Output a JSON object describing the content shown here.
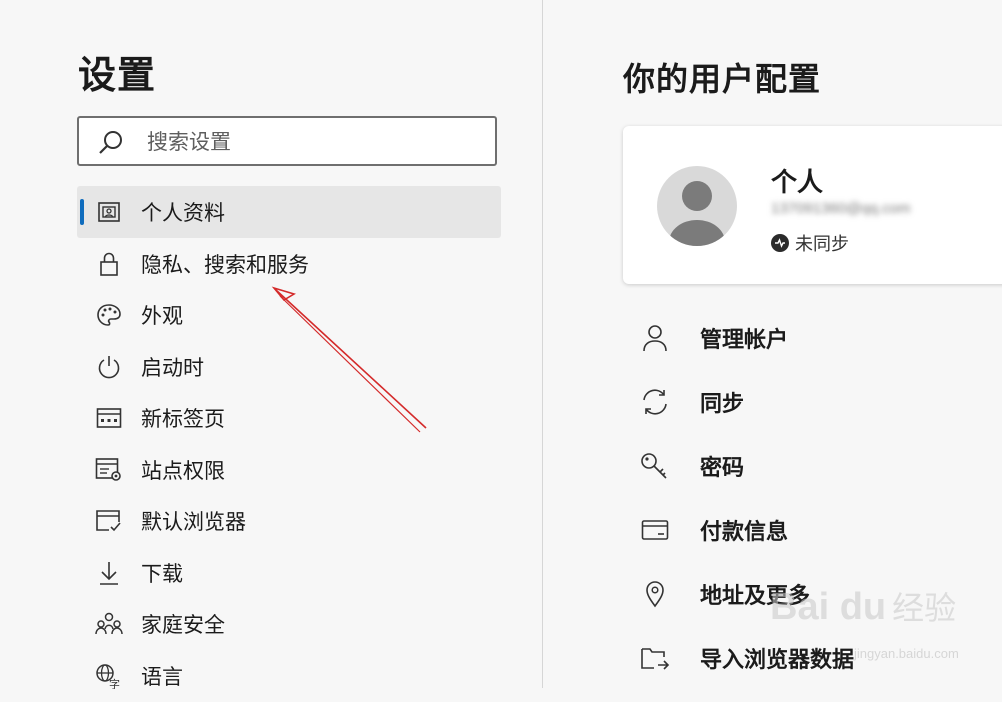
{
  "settings": {
    "title": "设置",
    "search_placeholder": "搜索设置",
    "nav": [
      {
        "label": "个人资料",
        "icon": "profile-icon",
        "active": true
      },
      {
        "label": "隐私、搜索和服务",
        "icon": "lock-icon"
      },
      {
        "label": "外观",
        "icon": "palette-icon"
      },
      {
        "label": "启动时",
        "icon": "power-icon"
      },
      {
        "label": "新标签页",
        "icon": "new-tab-icon"
      },
      {
        "label": "站点权限",
        "icon": "site-permissions-icon"
      },
      {
        "label": "默认浏览器",
        "icon": "default-browser-icon"
      },
      {
        "label": "下载",
        "icon": "download-icon"
      },
      {
        "label": "家庭安全",
        "icon": "family-icon"
      },
      {
        "label": "语言",
        "icon": "language-icon"
      }
    ]
  },
  "profile": {
    "title": "你的用户配置",
    "name": "个人",
    "email": "137091360@qq.com",
    "sync_status": "未同步",
    "menu": [
      {
        "label": "管理帐户",
        "icon": "person-icon"
      },
      {
        "label": "同步",
        "icon": "sync-icon"
      },
      {
        "label": "密码",
        "icon": "key-icon"
      },
      {
        "label": "付款信息",
        "icon": "card-icon"
      },
      {
        "label": "地址及更多",
        "icon": "location-icon"
      },
      {
        "label": "导入浏览器数据",
        "icon": "import-icon"
      }
    ]
  },
  "watermark": {
    "logo": "Bai du",
    "text": "经验",
    "url": "jingyan.baidu.com"
  },
  "colors": {
    "accent": "#0f6cbd",
    "background": "#f7f7f7",
    "annotation": "#d42a2a"
  }
}
